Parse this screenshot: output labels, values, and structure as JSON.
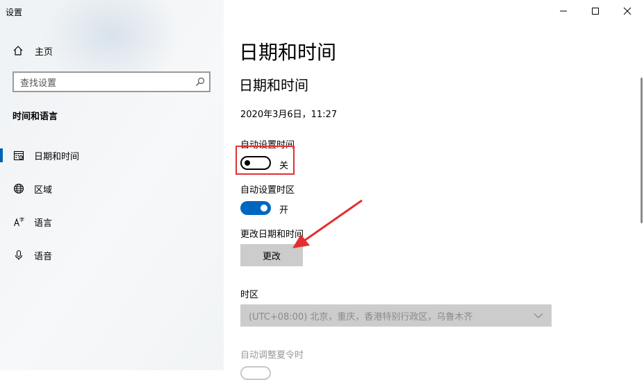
{
  "window": {
    "title": "设置"
  },
  "sidebar": {
    "home_label": "主页",
    "search_placeholder": "查找设置",
    "section_title": "时间和语言",
    "items": [
      {
        "label": "日期和时间",
        "icon": "calendar-icon",
        "active": true
      },
      {
        "label": "区域",
        "icon": "globe-icon",
        "active": false
      },
      {
        "label": "语言",
        "icon": "language-icon",
        "active": false
      },
      {
        "label": "语音",
        "icon": "microphone-icon",
        "active": false
      }
    ]
  },
  "main": {
    "page_title": "日期和时间",
    "section_title": "日期和时间",
    "current_datetime": "2020年3月6日，11:27",
    "auto_time": {
      "label": "自动设置时间",
      "state": "关",
      "on": false
    },
    "auto_timezone": {
      "label": "自动设置时区",
      "state": "开",
      "on": true
    },
    "change_datetime": {
      "label": "更改日期和时间",
      "button": "更改"
    },
    "timezone": {
      "label": "时区",
      "value": "(UTC+08:00) 北京，重庆，香港特别行政区，乌鲁木齐"
    },
    "dst": {
      "label": "自动调整夏令时"
    }
  },
  "colors": {
    "accent": "#0067c0",
    "annotation": "#e3302f"
  }
}
